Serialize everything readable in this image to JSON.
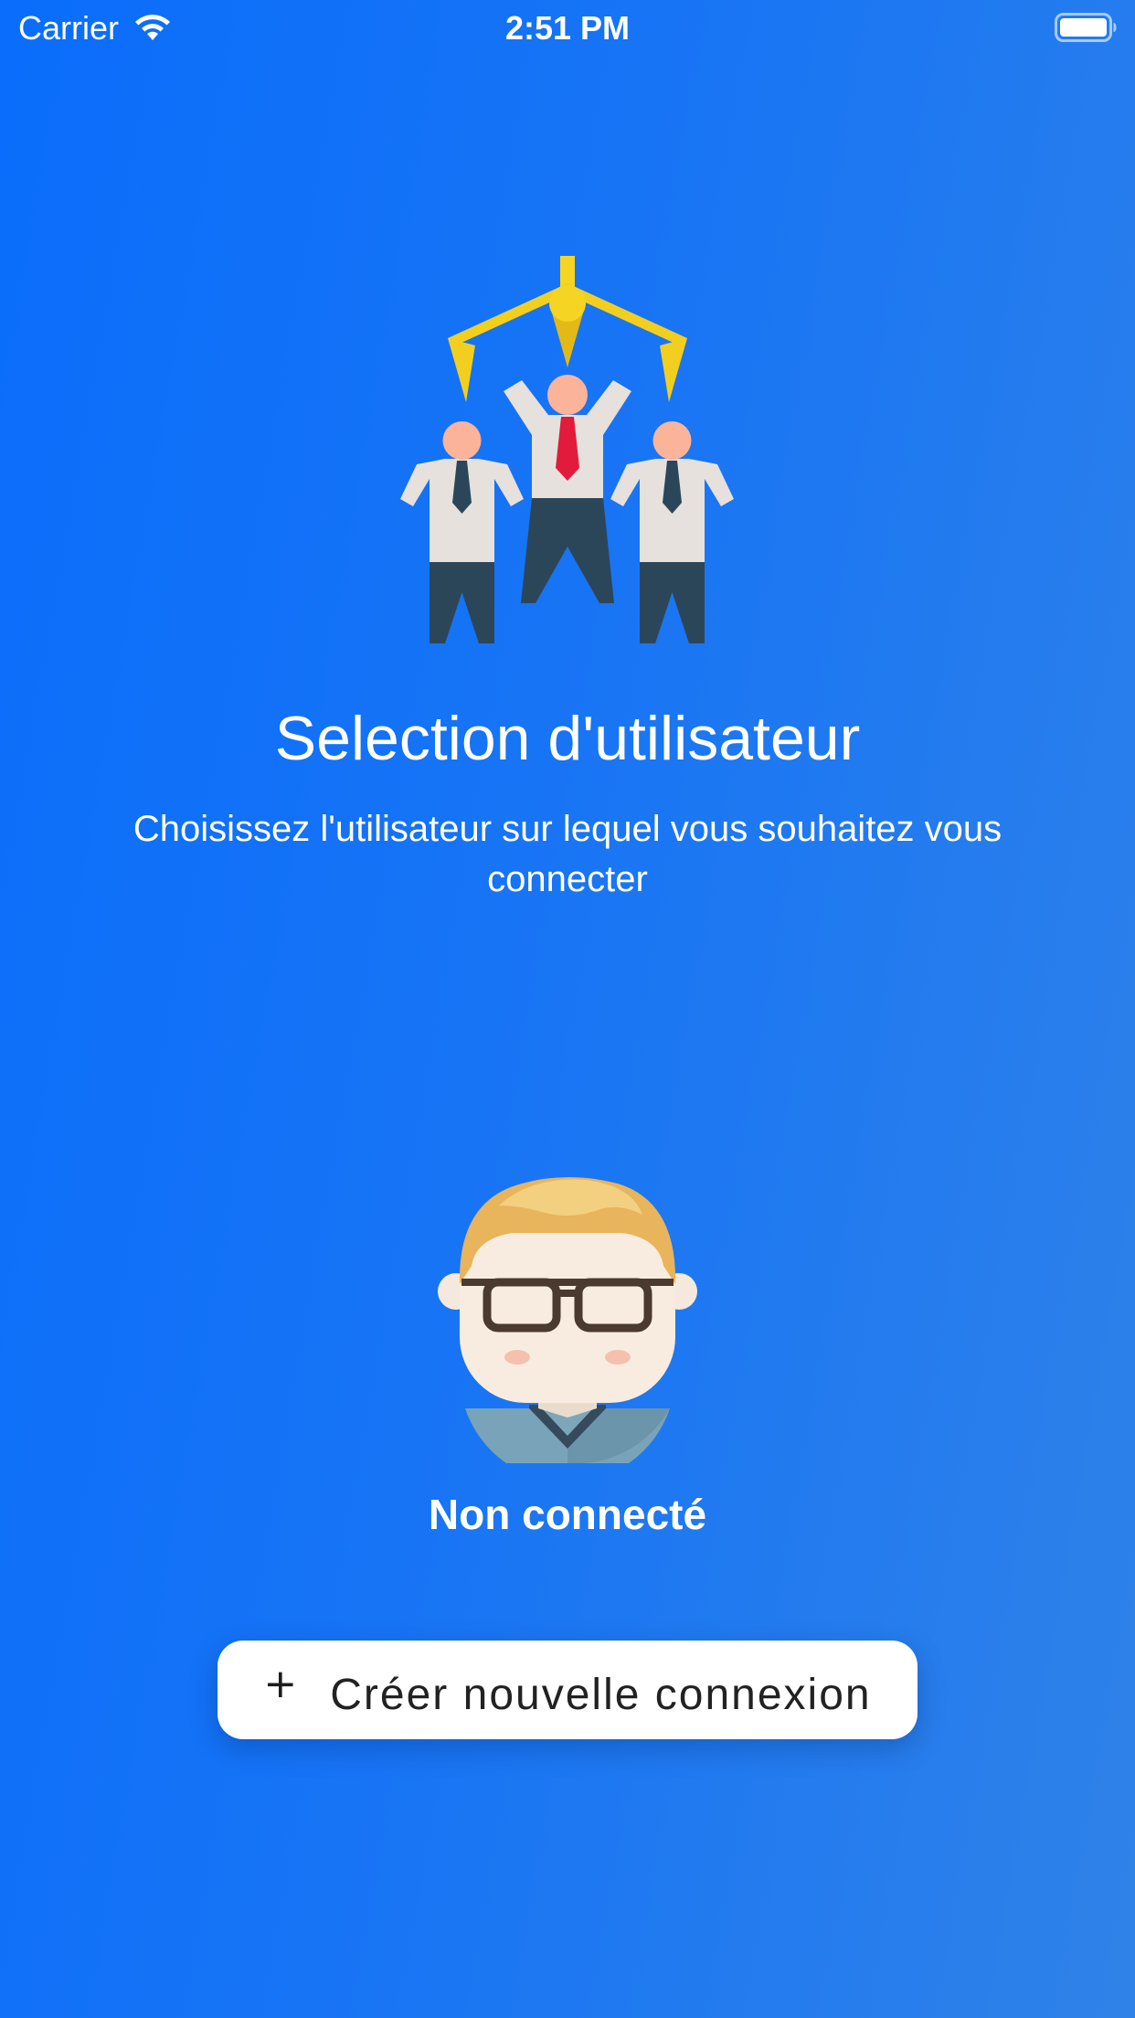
{
  "status_bar": {
    "carrier": "Carrier",
    "time": "2:51 PM",
    "icons": [
      "wifi-icon",
      "battery-icon"
    ]
  },
  "hero": {
    "illustration": "people-selection-claw-illustration",
    "title": "Selection d'utilisateur",
    "subtitle": "Choisissez l'utilisateur sur lequel vous souhaitez vous connecter"
  },
  "user": {
    "avatar": "user-avatar-glasses",
    "name": "Non connecté"
  },
  "actions": {
    "create_icon": "+",
    "create_label": "Créer nouvelle connexion"
  },
  "colors": {
    "background_start": "#0a6dfb",
    "background_end": "#2f82e8",
    "button_bg": "#ffffff",
    "button_text": "#222222",
    "claw": "#f2cf1f",
    "suit_dark": "#2c4659",
    "shirt": "#e6e1dc",
    "skin": "#fbb399",
    "tie_red": "#e21b3c"
  }
}
